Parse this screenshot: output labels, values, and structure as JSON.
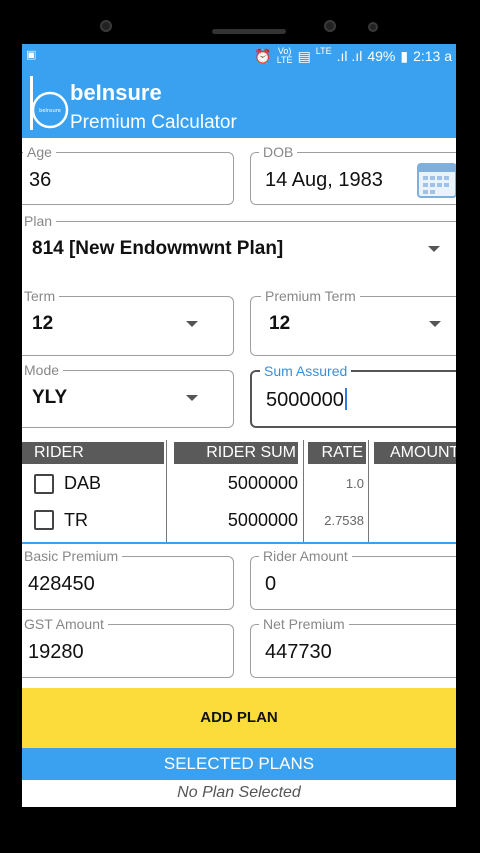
{
  "status_bar": {
    "network_top": "Vo)",
    "network_bottom": "LTE",
    "lte": "LTE",
    "battery": "49%",
    "time": "2:13 a"
  },
  "app": {
    "title": "beInsure",
    "subtitle": "Premium Calculator",
    "accent_color": "#3aa1f0",
    "button_color": "#fbdc3a"
  },
  "form": {
    "age_label": "Age",
    "age_value": "36",
    "dob_label": "DOB",
    "dob_value": "14 Aug, 1983",
    "plan_label": "Plan",
    "plan_value": "814 [New Endowmwnt Plan]",
    "term_label": "Term",
    "term_value": "12",
    "premium_term_label": "Premium Term",
    "premium_term_value": "12",
    "mode_label": "Mode",
    "mode_value": "YLY",
    "sum_assured_label": "Sum Assured",
    "sum_assured_value": "5000000"
  },
  "rider_table": {
    "headers": [
      "RIDER",
      "RIDER SUM",
      "RATE",
      "AMOUNT"
    ],
    "rows": [
      {
        "rider": "DAB",
        "sum": "5000000",
        "rate": "1.0",
        "amount": "",
        "checked": false
      },
      {
        "rider": "TR",
        "sum": "5000000",
        "rate": "2.7538",
        "amount": "",
        "checked": false
      }
    ]
  },
  "results": {
    "basic_premium_label": "Basic Premium",
    "basic_premium_value": "428450",
    "rider_amount_label": "Rider Amount",
    "rider_amount_value": "0",
    "gst_label": "GST Amount",
    "gst_value": "19280",
    "net_premium_label": "Net Premium",
    "net_premium_value": "447730"
  },
  "actions": {
    "add_plan": "ADD PLAN",
    "selected_plans": "SELECTED PLANS",
    "no_plan": "No Plan Selected"
  }
}
